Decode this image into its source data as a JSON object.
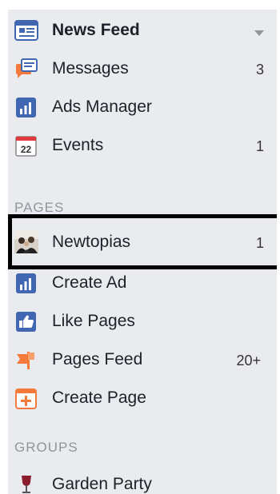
{
  "nav": {
    "items": [
      {
        "name": "news-feed",
        "label": "News Feed",
        "icon": "news-feed-icon",
        "count": ""
      },
      {
        "name": "messages",
        "label": "Messages",
        "icon": "messages-icon",
        "count": "3"
      },
      {
        "name": "ads-manager",
        "label": "Ads Manager",
        "icon": "ads-manager-icon",
        "count": ""
      },
      {
        "name": "events",
        "label": "Events",
        "icon": "events-icon",
        "count": "1",
        "icon_text": "22"
      }
    ]
  },
  "pages": {
    "heading": "PAGES",
    "items": [
      {
        "name": "newtopias",
        "label": "Newtopias",
        "icon": "newtopias-avatar-icon",
        "count": "1"
      },
      {
        "name": "create-ad",
        "label": "Create Ad",
        "icon": "create-ad-icon",
        "count": ""
      },
      {
        "name": "like-pages",
        "label": "Like Pages",
        "icon": "like-pages-icon",
        "count": ""
      },
      {
        "name": "pages-feed",
        "label": "Pages Feed",
        "icon": "pages-feed-icon",
        "count": "20+"
      },
      {
        "name": "create-page",
        "label": "Create Page",
        "icon": "create-page-icon",
        "count": ""
      }
    ]
  },
  "groups": {
    "heading": "GROUPS",
    "items": [
      {
        "name": "garden-party",
        "label": "Garden Party",
        "icon": "wine-glass-icon",
        "count": ""
      }
    ]
  },
  "colors": {
    "panel_bg": "#e9ebee",
    "text": "#1d2129",
    "muted": "#90949c",
    "facebook_blue": "#4267b2",
    "orange": "#f5793a"
  }
}
